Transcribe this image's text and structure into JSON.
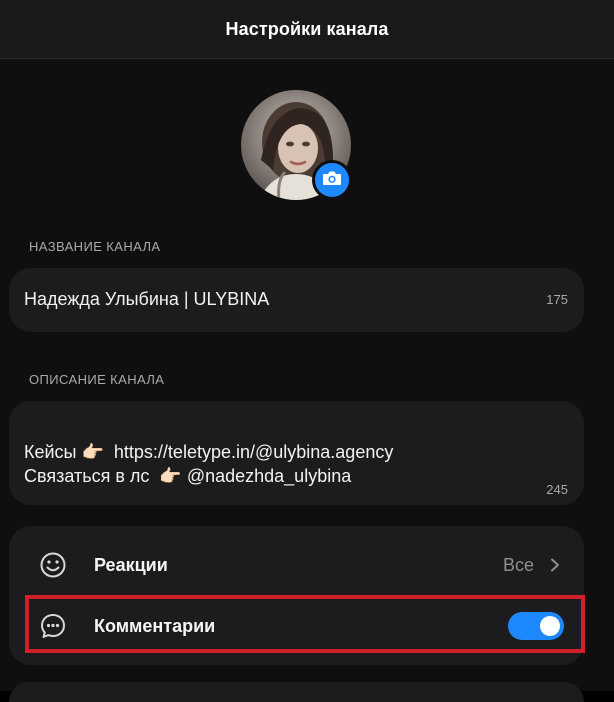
{
  "header": {
    "title": "Настройки канала"
  },
  "avatar": {
    "camera_icon": "camera-icon"
  },
  "channel_name": {
    "section_label": "НАЗВАНИЕ КАНАЛА",
    "value": "Надежда Улыбина | ULYBINA",
    "counter": "175"
  },
  "channel_description": {
    "section_label": "ОПИСАНИЕ КАНАЛА",
    "value": "Кейсы 👉🏻  https://teletype.in/@ulybina.agency\nСвязаться в лс  👉🏻 @nadezhda_ulybina",
    "counter": "245"
  },
  "settings": {
    "reactions": {
      "label": "Реакции",
      "value": "Все",
      "icon": "smile-icon"
    },
    "comments": {
      "label": "Комментарии",
      "icon": "comment-bubble-icon",
      "enabled": true
    }
  },
  "colors": {
    "accent": "#1e88ff",
    "background": "#0f0f10",
    "card": "#1c1c1e",
    "highlight": "#d0202a"
  }
}
